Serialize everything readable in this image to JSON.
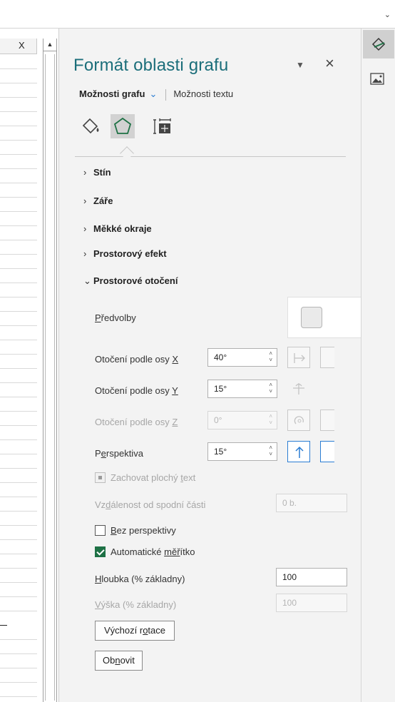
{
  "topbar": {
    "dropdown_icon": "chevron-down-icon"
  },
  "sheet": {
    "column_header": "X"
  },
  "pane": {
    "title": "Formát oblasti grafu",
    "tabs": {
      "chart_options": "Možnosti grafu",
      "text_options": "Možnosti textu"
    },
    "icons": [
      "fill-line-icon",
      "effects-pentagon-icon",
      "size-properties-icon"
    ],
    "sections": [
      {
        "label": "Stín",
        "expanded": false
      },
      {
        "label": "Záře",
        "expanded": false
      },
      {
        "label": "Měkké okraje",
        "expanded": false
      },
      {
        "label": "Prostorový efekt",
        "expanded": false
      },
      {
        "label": "Prostorové otočení",
        "expanded": true
      }
    ],
    "rotation": {
      "presets_label": "Předvolby",
      "x_label": "Otočení podle osy X",
      "x_value": "40°",
      "y_label": "Otočení podle osy Y",
      "y_value": "15°",
      "z_label": "Otočení podle osy Z",
      "z_value": "0°",
      "perspective_label": "Perspektiva",
      "perspective_value": "15°",
      "keep_flat_text_label": "Zachovat plochý text",
      "distance_label": "Vzdálenost od spodní části",
      "distance_value": "0 b.",
      "no_perspective_label": "Bez perspektivy",
      "no_perspective_checked": false,
      "autoscale_label": "Automatické měřítko",
      "autoscale_checked": true,
      "depth_label": "Hloubka (% základny)",
      "depth_value": "100",
      "height_label": "Výška (% základny)",
      "height_value": "100",
      "default_rotation_button": "Výchozí rotace",
      "reset_button": "Obnovit"
    }
  },
  "rail": {
    "buttons": [
      "format-chart-icon",
      "picture-icon"
    ]
  },
  "colors": {
    "title": "#1b6e7a",
    "accent": "#2a7dd3",
    "check": "#1e7145"
  }
}
